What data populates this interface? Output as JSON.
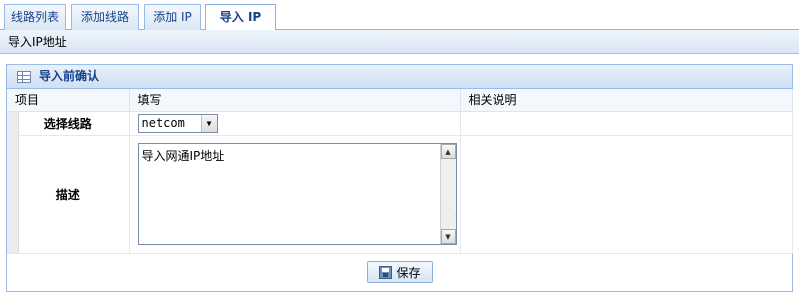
{
  "tabs": [
    {
      "label": "线路列表",
      "active": false
    },
    {
      "label": "添加线路",
      "active": false
    },
    {
      "label": "添加 IP",
      "active": false
    },
    {
      "label": "导入 IP",
      "active": true
    }
  ],
  "subheader": {
    "title": "导入IP地址"
  },
  "panel": {
    "title": "导入前确认",
    "columns": [
      "项目",
      "填写",
      "相关说明"
    ],
    "rows": [
      {
        "label": "选择线路",
        "field_value": "netcom",
        "note": ""
      },
      {
        "label": "描述",
        "field_value": "导入网通IP地址",
        "note": ""
      }
    ]
  },
  "actions": {
    "save_label": "保存"
  },
  "icons": {
    "panel": "grid-icon",
    "save": "disk-icon",
    "dropdown": "chevron-down-icon"
  },
  "colors": {
    "accent": "#15428b",
    "border": "#99bbe8"
  }
}
